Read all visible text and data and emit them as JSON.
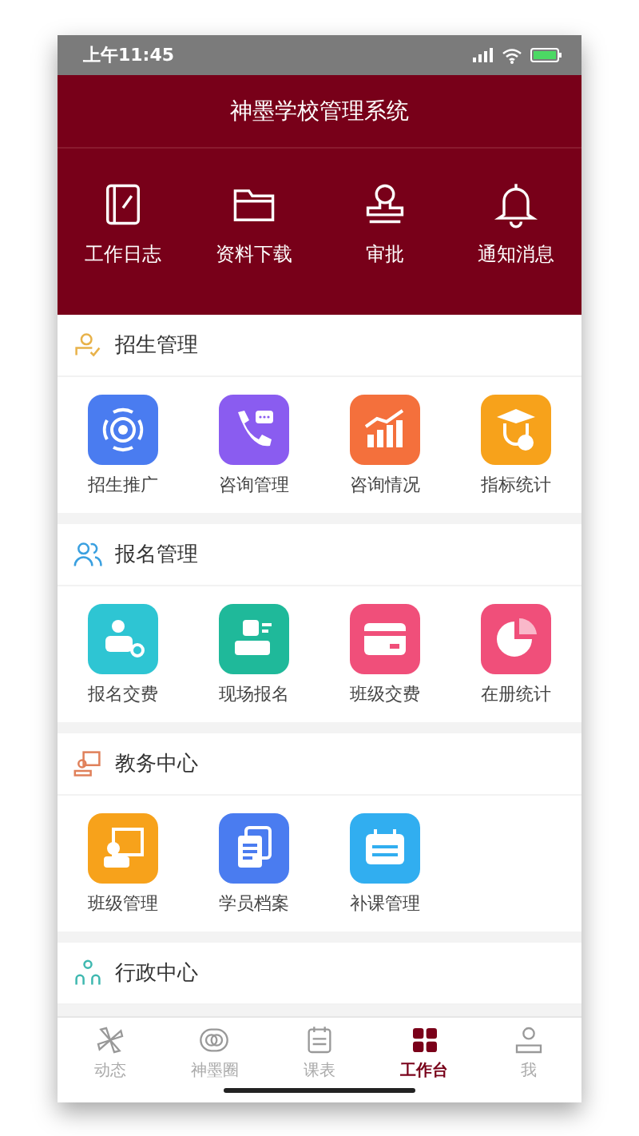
{
  "status_bar": {
    "time": "上午11:45"
  },
  "header": {
    "title": "神墨学校管理系统",
    "actions": [
      {
        "label": "工作日志",
        "kind": "notebook"
      },
      {
        "label": "资料下载",
        "kind": "folder"
      },
      {
        "label": "审批",
        "kind": "stamp"
      },
      {
        "label": "通知消息",
        "kind": "bell"
      }
    ]
  },
  "sections": [
    {
      "title": "招生管理",
      "kind": "recruit",
      "color": "#e8b24a",
      "items": [
        {
          "label": "招生推广",
          "kind": "target",
          "color": "#4a7cf0"
        },
        {
          "label": "咨询管理",
          "kind": "phone",
          "color": "#8a5cf0"
        },
        {
          "label": "咨询情况",
          "kind": "chart",
          "color": "#f4703c"
        },
        {
          "label": "指标统计",
          "kind": "graduate",
          "color": "#f7a21b"
        }
      ]
    },
    {
      "title": "报名管理",
      "kind": "people",
      "color": "#3aa0e0",
      "items": [
        {
          "label": "报名交费",
          "kind": "coin",
          "color": "#2ec5d3"
        },
        {
          "label": "现场报名",
          "kind": "desk",
          "color": "#1fb99a"
        },
        {
          "label": "班级交费",
          "kind": "card",
          "color": "#f04f7a"
        },
        {
          "label": "在册统计",
          "kind": "pie",
          "color": "#f04f7a"
        }
      ]
    },
    {
      "title": "教务中心",
      "kind": "teacher",
      "color": "#e0805a",
      "items": [
        {
          "label": "班级管理",
          "kind": "board",
          "color": "#f7a21b"
        },
        {
          "label": "学员档案",
          "kind": "docs",
          "color": "#4a7cf0"
        },
        {
          "label": "补课管理",
          "kind": "calendar",
          "color": "#31aef0"
        }
      ]
    },
    {
      "title": "行政中心",
      "kind": "network",
      "color": "#3fb8b0"
    }
  ],
  "tab_bar": [
    {
      "label": "动态",
      "kind": "pinwheel",
      "selected": false
    },
    {
      "label": "神墨圈",
      "kind": "rings",
      "selected": false
    },
    {
      "label": "课表",
      "kind": "schedule",
      "selected": false
    },
    {
      "label": "工作台",
      "kind": "grid",
      "selected": true
    },
    {
      "label": "我",
      "kind": "person",
      "selected": false
    }
  ]
}
